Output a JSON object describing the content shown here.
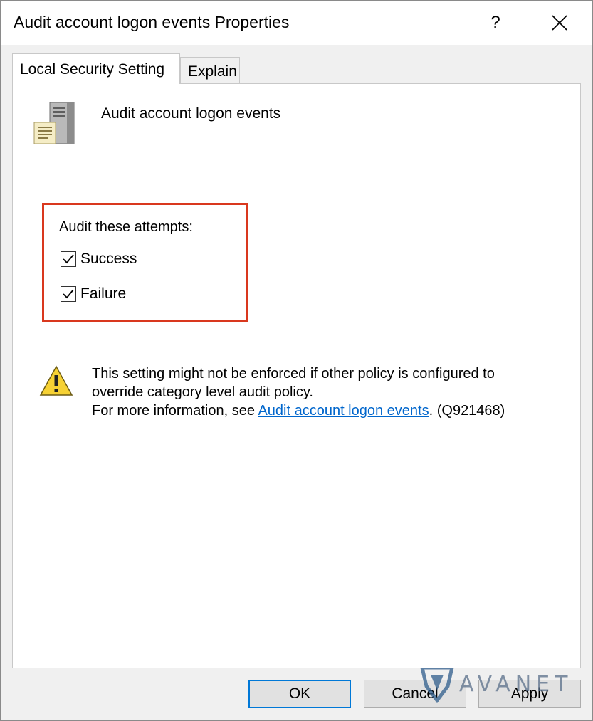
{
  "window": {
    "title": "Audit account logon events Properties",
    "help_label": "?"
  },
  "tabs": [
    {
      "label": "Local Security Setting",
      "active": true
    },
    {
      "label": "Explain",
      "active": false
    }
  ],
  "policy": {
    "name": "Audit account logon events",
    "icon": "server-document-icon"
  },
  "audit_group": {
    "label": "Audit these attempts:",
    "options": [
      {
        "label": "Success",
        "checked": true
      },
      {
        "label": "Failure",
        "checked": true
      }
    ],
    "highlight_color": "#d9381e"
  },
  "warning": {
    "icon": "warning-icon",
    "line1": "This setting might not be enforced if other policy is configured to",
    "line2": "override category level audit policy.",
    "line3_prefix": "For more information, see ",
    "link_text": "Audit account logon events",
    "line3_suffix": ". (Q921468)"
  },
  "buttons": {
    "ok": "OK",
    "cancel": "Cancel",
    "apply": "Apply"
  },
  "watermark": {
    "text": "AVANET"
  },
  "colors": {
    "accent": "#0078d7",
    "link": "#0066cc"
  }
}
